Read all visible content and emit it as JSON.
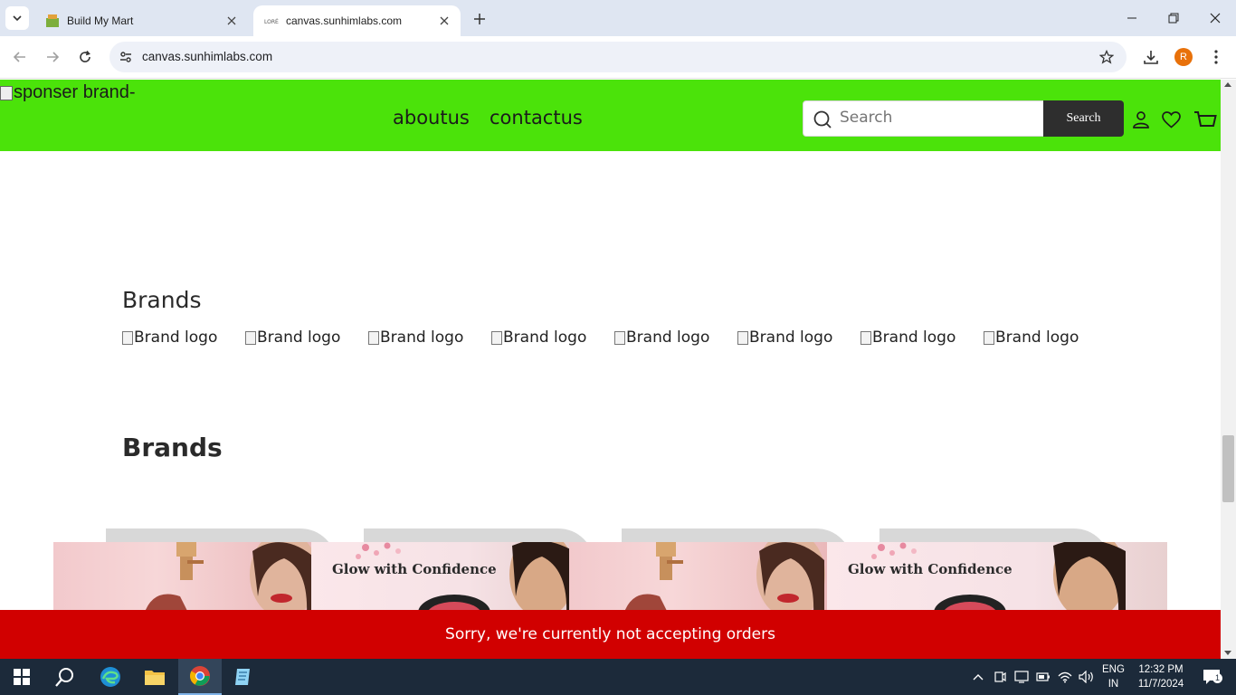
{
  "browser": {
    "tabs": [
      {
        "title": "Build My Mart",
        "active": false
      },
      {
        "title": "canvas.sunhimlabs.com",
        "active": true
      }
    ],
    "url": "canvas.sunhimlabs.com",
    "profile_initial": "R"
  },
  "header": {
    "sponsor_alt": "sponser brand-",
    "nav": [
      "aboutus",
      "contactus"
    ],
    "search_placeholder": "Search",
    "search_button": "Search",
    "bg_color": "#4be30a"
  },
  "sections": {
    "brands_logos_title": "Brands",
    "brand_logos": [
      "Brand logo",
      "Brand logo",
      "Brand logo",
      "Brand logo",
      "Brand logo",
      "Brand logo",
      "Brand logo",
      "Brand logo"
    ],
    "brands_banners_title": "Brands",
    "banners": [
      {
        "kind": "lipstick",
        "text": ""
      },
      {
        "kind": "glow",
        "text": "Glow with Confidence"
      },
      {
        "kind": "lipstick",
        "text": ""
      },
      {
        "kind": "glow",
        "text": "Glow with Confidence"
      }
    ]
  },
  "notice": {
    "text": "Sorry, we're currently not accepting orders",
    "color": "#d10000"
  },
  "taskbar": {
    "language": "ENG",
    "region": "IN",
    "time": "12:32 PM",
    "date": "11/7/2024",
    "notification_count": "1"
  }
}
